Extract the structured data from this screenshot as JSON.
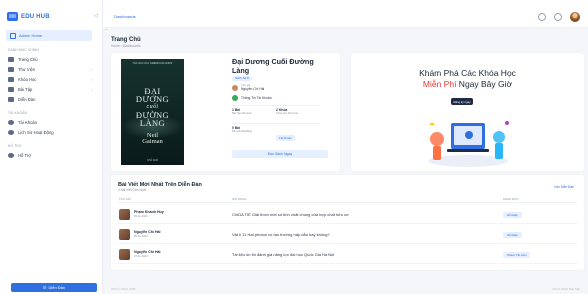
{
  "app": {
    "name": "EDU HUB"
  },
  "sidebar": {
    "admin_label": "Admin Home",
    "section_main": "DANH MỤC CHÍNH",
    "items": [
      {
        "label": "Trang Chủ",
        "icon": "home-icon"
      },
      {
        "label": "Thư Viện",
        "icon": "library-icon"
      },
      {
        "label": "Khóa Học",
        "icon": "course-icon"
      },
      {
        "label": "Bài Tập",
        "icon": "assignment-icon"
      },
      {
        "label": "Diễn Đàn",
        "icon": "forum-icon"
      }
    ],
    "section_account": "TÀI KHOẢN",
    "account_items": [
      {
        "label": "Tài Khoản",
        "icon": "user-icon"
      },
      {
        "label": "Lịch Sử Hoạt Động",
        "icon": "history-icon"
      }
    ],
    "section_support": "HỖ TRỢ",
    "support_items": [
      {
        "label": "Hỗ Trợ",
        "icon": "help-icon"
      }
    ],
    "bottom_button": "Diễn Đàn"
  },
  "topbar": {
    "breadcrumb": "Dashboards"
  },
  "page": {
    "title": "Trang Chủ",
    "breadcrumb": "Home › Dashboards"
  },
  "book": {
    "cover_top": "TÁC GIẢ CỦA 'AMERICAN GODS'",
    "cover_title_1": "ĐẠI",
    "cover_title_2": "DƯƠNG",
    "cover_title_3": "cuối",
    "cover_title_4": "ĐƯỜNG",
    "cover_title_5": "LÀNG",
    "cover_author_1": "Neil",
    "cover_author_2": "Gaiman",
    "cover_footer": "NHÃ NAM",
    "title": "Đại Dương Cuối Đường Làng",
    "badge": "Sách Số 8",
    "author_label": "Tác giả",
    "author": "Nguyễn Chí Hải",
    "uploader": "Thông Tin Tài Khoản",
    "stat1_value": "1 Bài",
    "stat1_label": "Bài Tập Đã Hoàn",
    "stat2_value": "2 Khóa",
    "stat2_label": "Khóa Học Đã Hoàn",
    "stat3_value": "0 Bài",
    "stat3_label": "Bài Viết Đã Đăng",
    "stat4_pill": "Tài Khoản",
    "read_button": "Đọc Sách Ngay"
  },
  "promo": {
    "line1": "Khám Phá Các Khóa Học",
    "line2_highlight": "Miễn Phí",
    "line2_rest": " Ngay Bây Giờ",
    "button": "Đăng ký ngay"
  },
  "posts": {
    "title": "Bài Viết Mới Nhất Trên Diễn Đàn",
    "subtitle": "3 Bài Viết Gần Nhất",
    "view_all": "Vào Diễn Đàn",
    "headers": {
      "author": "TÁC GIẢ",
      "content": "NỘI DUNG",
      "category": "DANH MỤC"
    },
    "rows": [
      {
        "name": "Phạm Khánh Huy",
        "date": "05-11-2024",
        "content": "ChIDA TIẾ Giải thích một số tính chất chung của hợp chất hữu cơ",
        "tag": "Hỏi Đáp"
      },
      {
        "name": "Nguyễn Chí Hải",
        "date": "05-11-2024",
        "content": "Vật lí 11 Hạt photon có tạo trường hấp dẫn hay không?",
        "tag": "Hỏi Đáp"
      },
      {
        "name": "Nguyễn Chí Hải",
        "date": "07-11-2024",
        "content": "Tài liệu ôn thi đánh giá năng lực đại học Quốc Gia Hà Nội",
        "tag": "Share Tài Liệu"
      }
    ]
  },
  "footer": {
    "left": "2024 © EDU HUB",
    "right": "Chính Sách Bảo Mật"
  },
  "colors": {
    "accent": "#2f6fe0",
    "highlight": "#e53935",
    "dark": "#1f2a44"
  }
}
